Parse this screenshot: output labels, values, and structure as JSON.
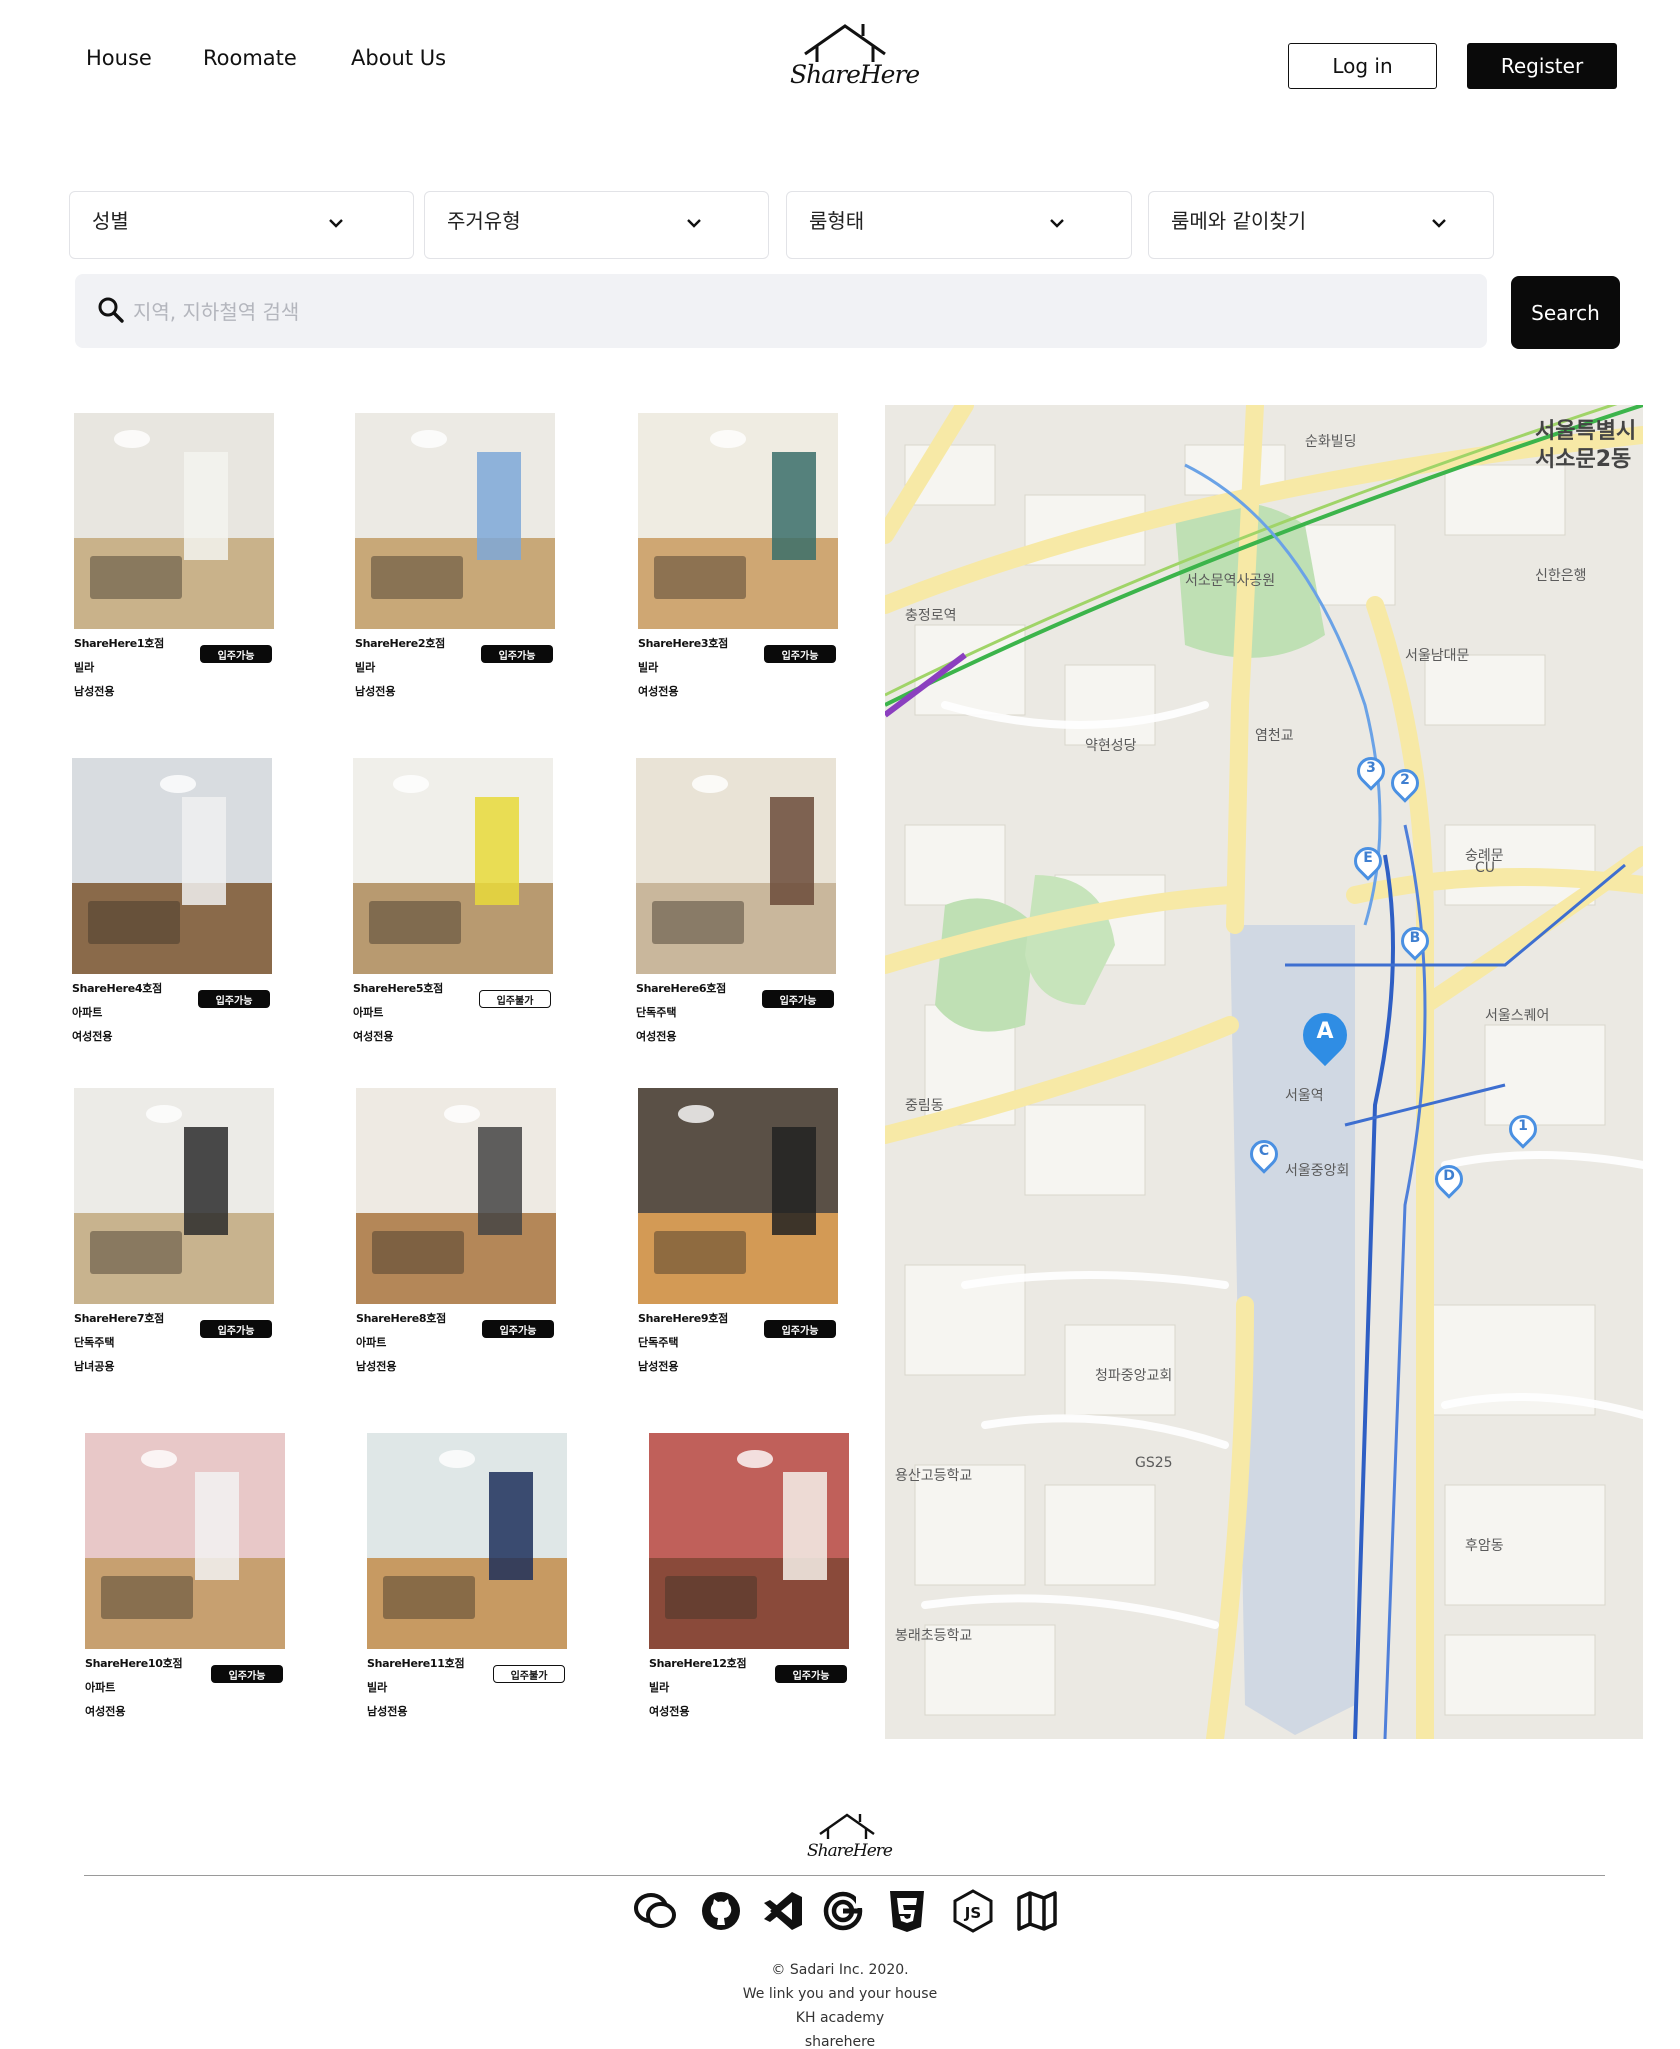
{
  "nav": {
    "links": [
      "House",
      "Roomate",
      "About Us"
    ],
    "logo_text": "ShareHere",
    "login_label": "Log in",
    "register_label": "Register"
  },
  "filters": [
    "성별",
    "주거유형",
    "룸형태",
    "룸메와 같이찾기"
  ],
  "search": {
    "placeholder": "지역, 지하철역 검색",
    "button_label": "Search"
  },
  "listings": [
    {
      "name": "ShareHere1호점",
      "type": "빌라",
      "gender": "남성전용",
      "status": "입주가능"
    },
    {
      "name": "ShareHere2호점",
      "type": "빌라",
      "gender": "남성전용",
      "status": "입주가능"
    },
    {
      "name": "ShareHere3호점",
      "type": "빌라",
      "gender": "여성전용",
      "status": "입주가능"
    },
    {
      "name": "ShareHere4호점",
      "type": "아파트",
      "gender": "여성전용",
      "status": "입주가능"
    },
    {
      "name": "ShareHere5호점",
      "type": "아파트",
      "gender": "여성전용",
      "status": "입주불가"
    },
    {
      "name": "ShareHere6호점",
      "type": "단독주택",
      "gender": "여성전용",
      "status": "입주가능"
    },
    {
      "name": "ShareHere7호점",
      "type": "단독주택",
      "gender": "남녀공용",
      "status": "입주가능"
    },
    {
      "name": "ShareHere8호점",
      "type": "아파트",
      "gender": "남성전용",
      "status": "입주가능"
    },
    {
      "name": "ShareHere9호점",
      "type": "단독주택",
      "gender": "남성전용",
      "status": "입주가능"
    },
    {
      "name": "ShareHere10호점",
      "type": "아파트",
      "gender": "여성전용",
      "status": "입주가능"
    },
    {
      "name": "ShareHere11호점",
      "type": "빌라",
      "gender": "남성전용",
      "status": "입주불가"
    },
    {
      "name": "ShareHere12호점",
      "type": "빌라",
      "gender": "여성전용",
      "status": "입주가능"
    }
  ],
  "map": {
    "labels": [
      "서울특별시",
      "서소문2동",
      "서소문역사공원",
      "순화빌딩",
      "충정로역",
      "서울역",
      "신한은행",
      "서울스퀘어",
      "숭례문",
      "서울남대문",
      "약현성당",
      "청파중앙교회",
      "용산고등학교",
      "봉래초등학교",
      "염천교",
      "서울중앙회",
      "중림동",
      "후암동",
      "GS25",
      "CU"
    ],
    "pins": [
      "A",
      "B",
      "C",
      "D",
      "E",
      "1",
      "2",
      "3"
    ]
  },
  "footer": {
    "logo_text": "ShareHere",
    "icons": [
      "chat-icon",
      "github-icon",
      "visual-studio-icon",
      "google-icon",
      "css3-icon",
      "nodejs-icon",
      "map-icon"
    ],
    "copyright": "© Sadari Inc. 2020.",
    "tagline": "We link you and your house",
    "academy": "KH academy",
    "site": "sharehere"
  }
}
